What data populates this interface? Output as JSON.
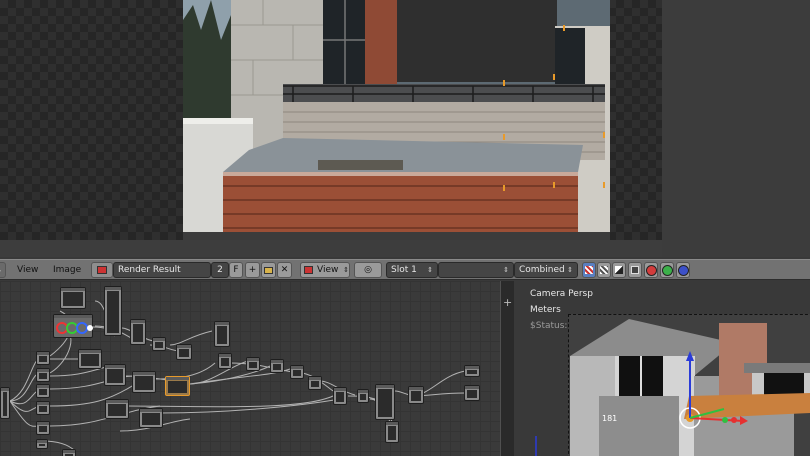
{
  "header": {
    "menu_view": "View",
    "menu_image": "Image",
    "image_name": "Render Result",
    "users_count": "2",
    "fake_user": "F",
    "view_label": "View",
    "slot_label": "Slot 1",
    "pass_label": "Combined"
  },
  "viewport": {
    "camera_label": "Camera Persp",
    "units_label": "Meters",
    "status_label": "$Status: UNDEFINED"
  },
  "colors": {
    "header_bg": "#727272",
    "selection_accent": "#e89a2a",
    "node_body": "#8a8a8a"
  },
  "icons": [
    "image-editor-icon",
    "image-browse-icon",
    "add-image-icon",
    "open-image-icon",
    "close-icon",
    "view-mode-icon",
    "display-alpha-icon",
    "display-color-alpha-icon",
    "display-z-icon",
    "display-r-icon",
    "display-g-icon",
    "display-b-icon",
    "add-icon"
  ]
}
